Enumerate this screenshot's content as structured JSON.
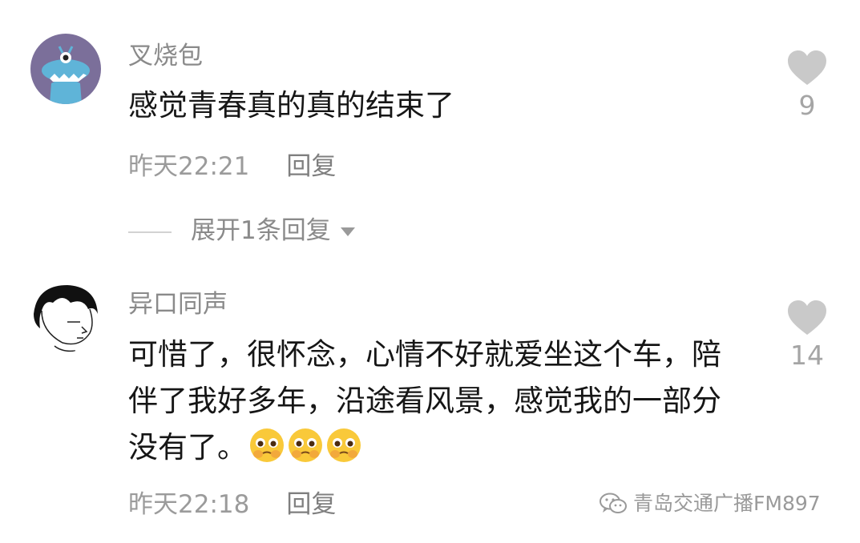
{
  "comments": [
    {
      "username": "叉烧包",
      "text": "感觉青春真的真的结束了",
      "time": "昨天22:21",
      "reply_label": "回复",
      "likes": "9",
      "avatar_icon": "blue-monster-avatar"
    },
    {
      "username": "异口同声",
      "text": "可惜了，很怀念，心情不好就爱坐这个车，陪伴了我好多年，沿途看风景，感觉我的一部分没有了。",
      "emojis": [
        "pleading-face-emoji",
        "pleading-face-emoji",
        "pleading-face-emoji"
      ],
      "time": "昨天22:18",
      "reply_label": "回复",
      "likes": "14",
      "avatar_icon": "black-hair-sketch-avatar"
    }
  ],
  "expand_replies": {
    "label": "展开1条回复"
  },
  "watermark": {
    "text": "青岛交通广播FM897",
    "icon": "wechat-icon"
  },
  "colors": {
    "avatar1_bg": "#7b6f9a",
    "avatar1_monster": "#5fb4d8",
    "like_heart": "#c9c9c9",
    "meta_text": "#9b9b9b"
  }
}
